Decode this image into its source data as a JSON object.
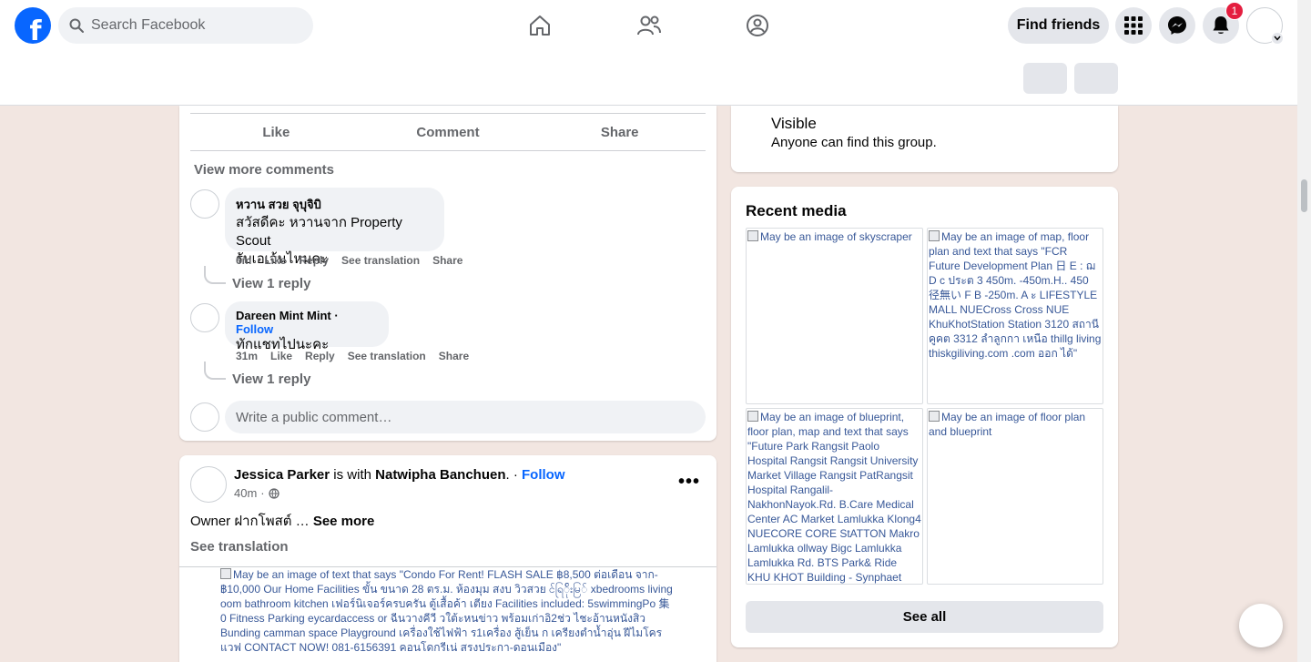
{
  "header": {
    "search_placeholder": "Search Facebook",
    "find_friends_label": "Find friends",
    "notifications_count": "1"
  },
  "post1": {
    "actions": {
      "like": "Like",
      "comment": "Comment",
      "share": "Share"
    },
    "view_more_comments": "View more comments",
    "comments": [
      {
        "author": "หวาน สวย จุบุจิบิ",
        "text_line1": "สวัสดีคะ หวานจาก Property Scout",
        "text_line2": "รับเอเจ้นไหมคะ",
        "time": "6m",
        "like": "Like",
        "reply": "Reply",
        "see_translation": "See translation",
        "share": "Share",
        "view_replies": "View 1 reply"
      },
      {
        "author": "Dareen Mint Mint",
        "follow": "Follow",
        "text_line1": "ทักแชทไปนะคะ",
        "time": "31m",
        "like": "Like",
        "reply": "Reply",
        "see_translation": "See translation",
        "share": "Share",
        "view_replies": "View 1 reply"
      }
    ],
    "write_comment_placeholder": "Write a public comment…"
  },
  "post2": {
    "author": "Jessica Parker",
    "with_text": "is with",
    "tagged": "Natwipha Banchuen",
    "follow": "Follow",
    "time": "40m",
    "text": "Owner ฝากโพสต์ …",
    "see_more": "See more",
    "see_translation": "See translation",
    "image_alt": "May be an image of text that says \"Condo For Rent! FLASH SALE ฿8,500 ต่อเดือน จาก-฿10,000 Our Home Facilities ขั้น ขนาด 28 ตร.ม. ห้องมุม สงบ วิวสวย င်ရြ်ိုးမြ် xbedrooms living oom bathroom kitchen เฟอร์นิเจอร์ครบครัน ตู้เสื้อค้า เตียง Facilities included: 5swimmingPo 集0 Fitness Parking eycardaccess or ฉีนวางคีวี วใต้ะหนข่าว พร้อมเก่าอิ2ช่ว ไชะอ้านหนังสิว Bunding camman space Playground เครื่องใช้ไฟฟ้า ร1เครื่อง สู้เย็น ก เครียงตำน้ำอุ่น ฝีไมโครแวฟ CONTACT NOW! 081-6156391 คอนโดกรีเน่ สรงประกา-ดอนเมือง\""
  },
  "about": {
    "visible_title": "Visible",
    "visible_desc": "Anyone can find this group."
  },
  "recent_media": {
    "title": "Recent media",
    "items": [
      "May be an image of skyscraper",
      "May be an image of map, floor plan and text that says \"FCR Future Development Plan 日 E : ฌ D c ประต 3 450m. -450m.H.. 450 径無い F B -250m. A ะ LIFESTYLE MALL NUECross Cross NUE KhuKhotStation Station 3120 สถานี คูคต 3312 ลำลูกกา เหนือ thillg living thiskgiliving.com .com ออก ได้\"",
      "May be an image of blueprint, floor plan, map and text that says \"Future Park Rangsit Paolo Hospital Rangsit Rangsit University Market Village Rangsit PatRangsit Hospital Rangalil-NakhonNayok.Rd. B.Care Medical Center AC Market Lamlukka Klong4 NUECORE CORE StATTON Makro Lamlukka ollway Bigc Lamlukka Lamlukka Rd. BTS Park& Ride KHU KHOT Building - Synphaet Hospital",
      "May be an image of floor plan and blueprint"
    ],
    "see_all": "See all"
  }
}
